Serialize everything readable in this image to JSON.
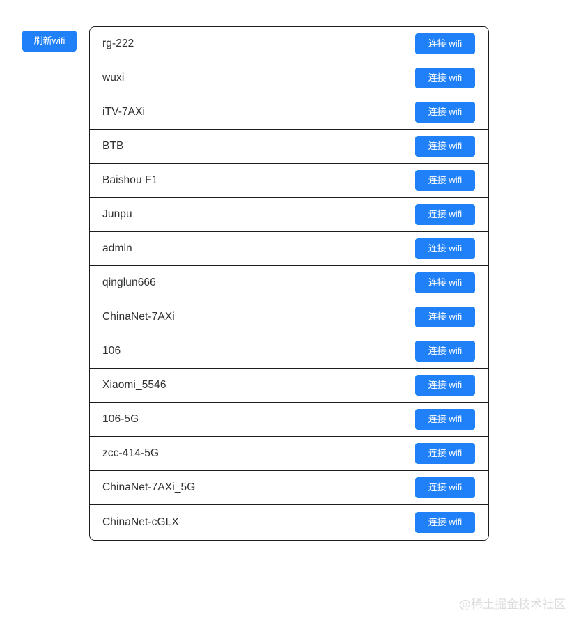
{
  "page": {
    "background_color": "#ffffff",
    "accent_color": "#2080f8",
    "text_color": "#303133",
    "border_color": "#1d1d1d"
  },
  "toolbar": {
    "refresh_label": "刷新wifi"
  },
  "wifi_list": {
    "connect_label": "连接 wifi",
    "items": [
      {
        "ssid": "rg-222"
      },
      {
        "ssid": "wuxi"
      },
      {
        "ssid": "iTV-7AXi"
      },
      {
        "ssid": "BTB"
      },
      {
        "ssid": "Baishou F1"
      },
      {
        "ssid": "Junpu"
      },
      {
        "ssid": "admin"
      },
      {
        "ssid": "qinglun666"
      },
      {
        "ssid": "ChinaNet-7AXi"
      },
      {
        "ssid": "106"
      },
      {
        "ssid": "Xiaomi_5546"
      },
      {
        "ssid": "106-5G"
      },
      {
        "ssid": "zcc-414-5G"
      },
      {
        "ssid": "ChinaNet-7AXi_5G"
      },
      {
        "ssid": "ChinaNet-cGLX"
      }
    ]
  },
  "watermark": {
    "text": "@稀土掘金技术社区"
  }
}
